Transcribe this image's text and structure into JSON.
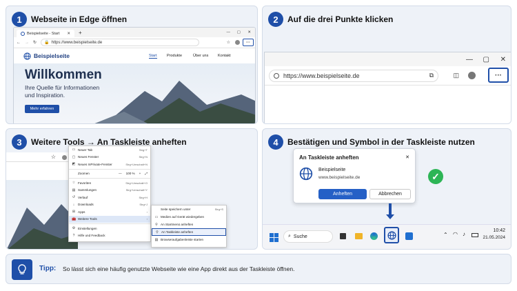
{
  "steps": [
    {
      "number": "1",
      "title": "Webseite in Edge öffnen"
    },
    {
      "number": "2",
      "title": "Auf die drei Punkte klicken"
    },
    {
      "number": "3",
      "title": "Weitere Tools → An Taskleiste anheften"
    },
    {
      "number": "4",
      "title": "Bestätigen und Symbol in der Taskleiste nutzen"
    }
  ],
  "browser": {
    "tab_title": "Beispielseite - Start",
    "url": "https://www.beispielseite.de",
    "more_glyph": "···"
  },
  "site": {
    "brand": "Beispielseite",
    "nav": [
      "Start",
      "Produkte",
      "Über uns",
      "Kontakt"
    ],
    "hero_title": "Willkommen",
    "hero_subtitle_1": "Ihre Quelle für Informationen",
    "hero_subtitle_2": "und Inspiration.",
    "cta": "Mehr erfahren"
  },
  "menu": [
    {
      "icon": "tab-icon",
      "glyph": "▭",
      "label": "Neuer Tab",
      "shortcut": "Strg+T"
    },
    {
      "icon": "window-icon",
      "glyph": "▢",
      "label": "Neues Fenster",
      "shortcut": "Strg+N"
    },
    {
      "icon": "inprivate-icon",
      "glyph": "◩",
      "label": "Neues InPrivate-Fenster",
      "shortcut": "Strg+Umschalt+N"
    },
    {
      "icon": "zoom-icon",
      "glyph": "",
      "label": "Zoomen",
      "shortcut": ""
    },
    {
      "icon": "star-icon",
      "glyph": "☆",
      "label": "Favoriten",
      "shortcut": "Strg+Umschalt+O"
    },
    {
      "icon": "collections-icon",
      "glyph": "▤",
      "label": "Sammlungen",
      "shortcut": "Strg+Umschalt+Y"
    },
    {
      "icon": "history-icon",
      "glyph": "↺",
      "label": "Verlauf",
      "shortcut": "Strg+H"
    },
    {
      "icon": "download-icon",
      "glyph": "↓",
      "label": "Downloads",
      "shortcut": "Strg+J"
    },
    {
      "icon": "apps-icon",
      "glyph": "⊞",
      "label": "Apps",
      "shortcut": ""
    },
    {
      "icon": "tools-icon",
      "glyph": "🧰",
      "label": "Weitere Tools",
      "shortcut": ""
    },
    {
      "icon": "settings-icon",
      "glyph": "⚙",
      "label": "Einstellungen",
      "shortcut": ""
    },
    {
      "icon": "help-icon",
      "glyph": "?",
      "label": "Hilfe und Feedback",
      "shortcut": ""
    }
  ],
  "zoom": {
    "minus": "—",
    "value": "100 %",
    "plus": "+"
  },
  "submenu": [
    {
      "icon": "",
      "label": "Seite speichern unter",
      "shortcut": "Strg+S"
    },
    {
      "icon": "cast-icon",
      "label": "Medien auf Gerät wiedergeben",
      "shortcut": ""
    },
    {
      "icon": "pin-icon",
      "label": "An Startmenü anheften",
      "shortcut": ""
    },
    {
      "icon": "pin-icon",
      "label": "An Taskleiste anheften",
      "shortcut": ""
    },
    {
      "icon": "task-icon",
      "label": "Browseraufgabenleiste starten",
      "shortcut": ""
    }
  ],
  "dialog": {
    "title": "An Taskleiste anheften",
    "site_name": "Beispielseite",
    "site_url": "www.beispielseite.de",
    "confirm": "Anheften",
    "cancel": "Abbrechen",
    "close": "✕"
  },
  "taskbar": {
    "search": "Suche",
    "time": "10:42",
    "date": "21.05.2024"
  },
  "tip": {
    "label": "Tipp:",
    "text": "So lässt sich eine häufig genutzte Webseite wie eine App direkt aus der Taskleiste öffnen."
  },
  "colors": {
    "accent": "#1f4fa8",
    "confirm": "#2560c6",
    "check": "#2db556"
  }
}
